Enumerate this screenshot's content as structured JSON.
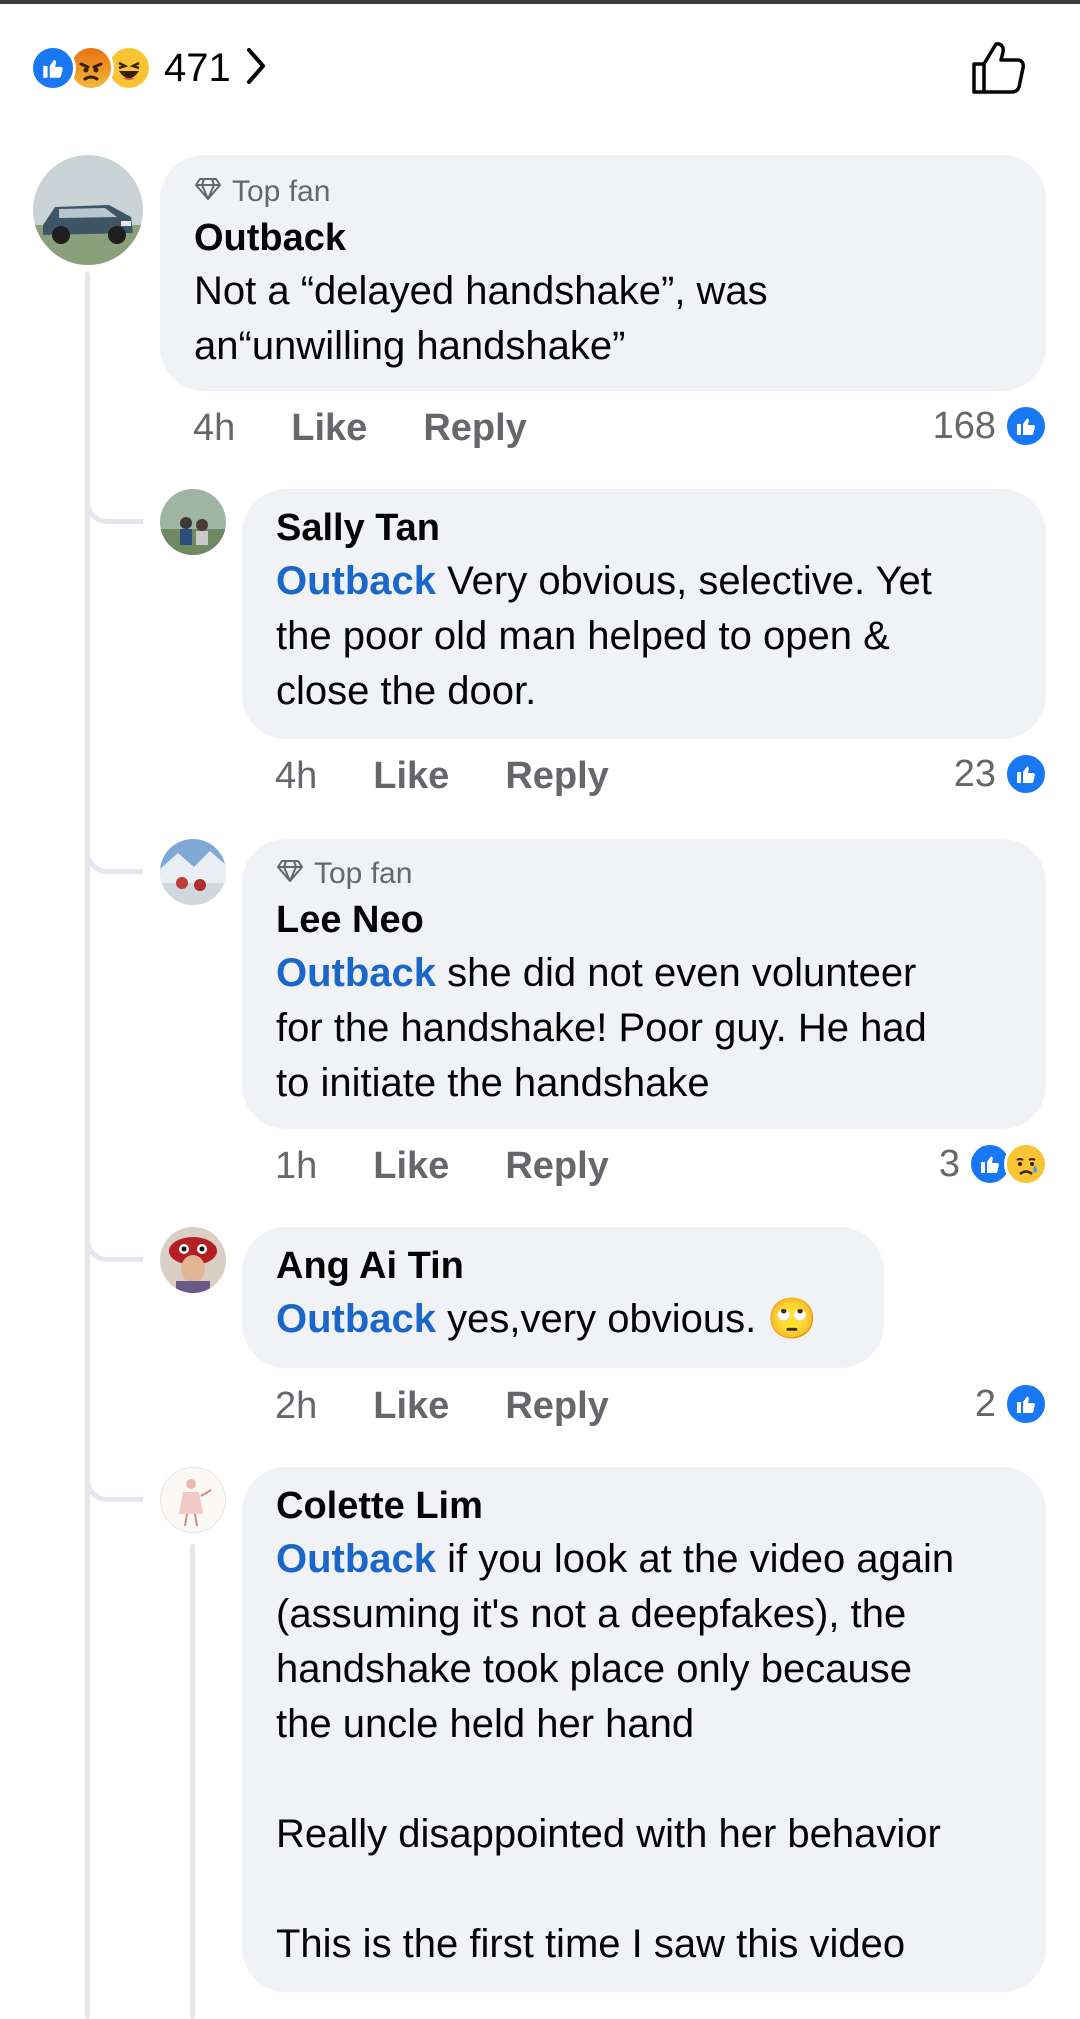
{
  "reactions_header": {
    "count": "471",
    "icons": [
      "like-reaction-icon",
      "angry-reaction-icon",
      "haha-reaction-icon"
    ]
  },
  "colors": {
    "bubble": "#f0f2f5",
    "mention": "#1b66c9",
    "like_blue": "#1877f2",
    "meta_gray": "#65676b",
    "thread_line": "#e4e6eb"
  },
  "main_comment": {
    "badge": "Top fan",
    "author": "Outback",
    "text": "Not a “delayed handshake”, was\nan“unwilling handshake”",
    "time": "4h",
    "like": "Like",
    "reply": "Reply",
    "reaction_count": "168"
  },
  "replies": [
    {
      "author": "Sally Tan",
      "mention": "Outback",
      "text": " Very obvious, selective. Yet\nthe poor old man helped to open &\nclose the door.",
      "time": "4h",
      "like": "Like",
      "reply": "Reply",
      "reaction_count": "23"
    },
    {
      "badge": "Top fan",
      "author": "Lee Neo",
      "mention": "Outback",
      "text": " she did not even volunteer\nfor the handshake! Poor guy. He had\nto initiate the handshake",
      "time": "1h",
      "like": "Like",
      "reply": "Reply",
      "reaction_count": "3"
    },
    {
      "author": "Ang Ai Tin",
      "mention": "Outback",
      "text": " yes,very obvious. 🙄",
      "time": "2h",
      "like": "Like",
      "reply": "Reply",
      "reaction_count": "2"
    },
    {
      "author": "Colette Lim",
      "mention": "Outback",
      "text": " if you look at the video again\n(assuming it's not a deepfakes), the\nhandshake took place only because\nthe uncle held her hand\n\nReally disappointed with her behavior\n\nThis is the first time I saw this video"
    }
  ]
}
